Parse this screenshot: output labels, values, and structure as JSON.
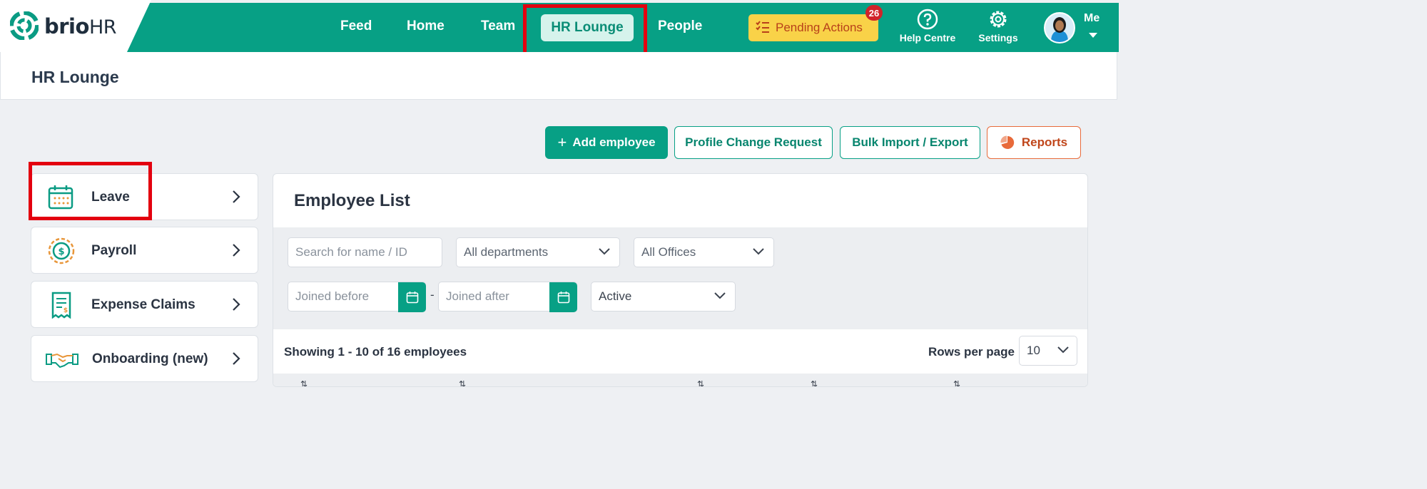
{
  "brand": {
    "name_main": "brio",
    "name_suffix": "HR",
    "colors": {
      "primary": "#07a085",
      "highlight": "#e3000f",
      "pending": "#f9d248",
      "badge": "#d1232a",
      "reports": "#e86a3a"
    }
  },
  "nav": {
    "items": [
      {
        "label": "Feed"
      },
      {
        "label": "Home"
      },
      {
        "label": "Team"
      },
      {
        "label": "HR Lounge",
        "active": true
      },
      {
        "label": "People"
      }
    ],
    "pending_label": "Pending Actions",
    "pending_count": "26",
    "help_label": "Help Centre",
    "settings_label": "Settings",
    "me_label": "Me"
  },
  "page": {
    "title": "HR Lounge"
  },
  "actions": {
    "add_employee": "Add employee",
    "profile_change": "Profile Change Request",
    "bulk_import": "Bulk Import / Export",
    "reports": "Reports"
  },
  "sidebar": {
    "items": [
      {
        "label": "Leave",
        "icon": "calendar-icon"
      },
      {
        "label": "Payroll",
        "icon": "dollar-coin-icon"
      },
      {
        "label": "Expense Claims",
        "icon": "receipt-icon"
      },
      {
        "label": "Onboarding (new)",
        "icon": "handshake-icon"
      }
    ]
  },
  "employee_list": {
    "title": "Employee List",
    "search_placeholder": "Search for name / ID",
    "department_select": "All departments",
    "office_select": "All Offices",
    "joined_before_placeholder": "Joined before",
    "joined_after_placeholder": "Joined after",
    "date_separator": "-",
    "status_select": "Active",
    "showing_text": "Showing 1 - 10 of 16 employees",
    "rows_per_page_label": "Rows per page",
    "rows_per_page_value": "10"
  }
}
